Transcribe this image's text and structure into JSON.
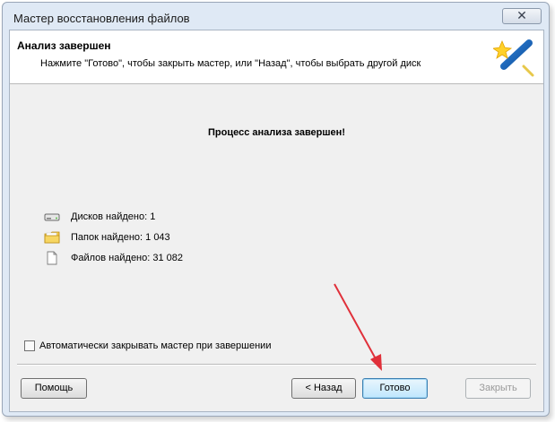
{
  "window": {
    "title": "Мастер восстановления файлов",
    "close_label": "✕"
  },
  "header": {
    "title": "Анализ завершен",
    "subtitle": "Нажмите \"Готово\", чтобы закрыть мастер, или \"Назад\", чтобы выбрать другой диск",
    "icon": "magic-wand-icon"
  },
  "main": {
    "status_title": "Процесс анализа завершен!",
    "stats": [
      {
        "icon": "disk-icon",
        "label": "Дисков найдено: 1"
      },
      {
        "icon": "folder-icon",
        "label": "Папок найдено: 1 043"
      },
      {
        "icon": "file-icon",
        "label": "Файлов найдено: 31 082"
      }
    ]
  },
  "options": {
    "auto_close_label": "Автоматически закрывать мастер при завершении",
    "auto_close_checked": false
  },
  "buttons": {
    "help": "Помощь",
    "back": "< Назад",
    "finish": "Готово",
    "close": "Закрыть"
  },
  "colors": {
    "annotation_arrow": "#e0303a",
    "primary_button_border": "#3c7fb1"
  }
}
